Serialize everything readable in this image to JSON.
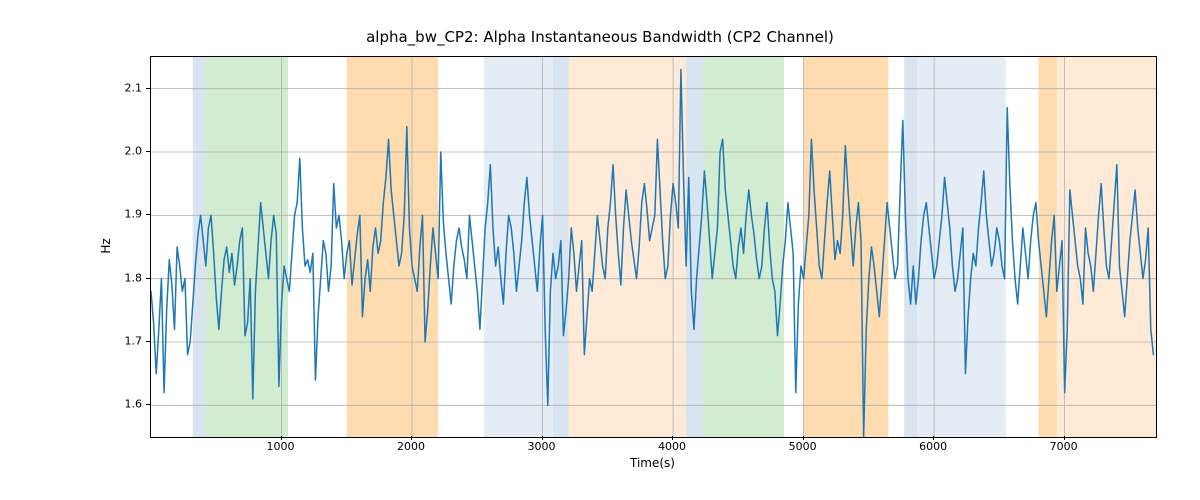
{
  "chart_data": {
    "type": "line",
    "title": "alpha_bw_CP2: Alpha Instantaneous Bandwidth (CP2 Channel)",
    "xlabel": "Time(s)",
    "ylabel": "Hz",
    "xlim": [
      0,
      7700
    ],
    "ylim": [
      1.55,
      2.15
    ],
    "x_ticks": [
      1000,
      2000,
      3000,
      4000,
      5000,
      6000,
      7000
    ],
    "y_ticks": [
      1.6,
      1.7,
      1.8,
      1.9,
      2.0,
      2.1
    ],
    "x_tick_labels": [
      "1000",
      "2000",
      "3000",
      "4000",
      "5000",
      "6000",
      "7000"
    ],
    "y_tick_labels": [
      "1.6",
      "1.7",
      "1.8",
      "1.9",
      "2.0",
      "2.1"
    ],
    "bands": [
      {
        "x0": 320,
        "x1": 420,
        "color": "blue"
      },
      {
        "x0": 420,
        "x1": 1050,
        "color": "green"
      },
      {
        "x0": 1500,
        "x1": 2200,
        "color": "orange"
      },
      {
        "x0": 2550,
        "x1": 3080,
        "color": "ltblue"
      },
      {
        "x0": 3080,
        "x1": 3200,
        "color": "blue"
      },
      {
        "x0": 3200,
        "x1": 4100,
        "color": "peach"
      },
      {
        "x0": 4100,
        "x1": 4230,
        "color": "blue"
      },
      {
        "x0": 4230,
        "x1": 4850,
        "color": "green"
      },
      {
        "x0": 5000,
        "x1": 5650,
        "color": "orange"
      },
      {
        "x0": 5770,
        "x1": 5870,
        "color": "blue"
      },
      {
        "x0": 5870,
        "x1": 6550,
        "color": "ltblue"
      },
      {
        "x0": 6800,
        "x1": 6940,
        "color": "orange"
      },
      {
        "x0": 6940,
        "x1": 7700,
        "color": "peach"
      }
    ],
    "series": [
      {
        "name": "alpha_bw_CP2",
        "x_start": 0,
        "x_step": 20,
        "y": [
          1.78,
          1.73,
          1.65,
          1.72,
          1.8,
          1.62,
          1.75,
          1.83,
          1.79,
          1.72,
          1.85,
          1.82,
          1.78,
          1.8,
          1.68,
          1.7,
          1.76,
          1.82,
          1.87,
          1.9,
          1.86,
          1.82,
          1.88,
          1.9,
          1.84,
          1.77,
          1.72,
          1.78,
          1.83,
          1.85,
          1.81,
          1.84,
          1.79,
          1.82,
          1.86,
          1.88,
          1.71,
          1.73,
          1.8,
          1.61,
          1.78,
          1.85,
          1.92,
          1.88,
          1.84,
          1.8,
          1.86,
          1.9,
          1.87,
          1.63,
          1.76,
          1.82,
          1.8,
          1.78,
          1.84,
          1.9,
          1.92,
          1.99,
          1.88,
          1.82,
          1.83,
          1.81,
          1.84,
          1.64,
          1.74,
          1.8,
          1.86,
          1.84,
          1.78,
          1.82,
          1.95,
          1.88,
          1.9,
          1.86,
          1.8,
          1.84,
          1.86,
          1.79,
          1.83,
          1.87,
          1.9,
          1.74,
          1.8,
          1.83,
          1.78,
          1.85,
          1.88,
          1.84,
          1.86,
          1.92,
          1.96,
          2.02,
          1.94,
          1.9,
          1.86,
          1.82,
          1.84,
          1.9,
          2.04,
          1.88,
          1.82,
          1.8,
          1.78,
          1.85,
          1.9,
          1.7,
          1.75,
          1.82,
          1.88,
          1.84,
          1.8,
          2.0,
          1.89,
          1.84,
          1.8,
          1.76,
          1.82,
          1.86,
          1.88,
          1.85,
          1.83,
          1.8,
          1.9,
          1.86,
          1.82,
          1.78,
          1.72,
          1.8,
          1.88,
          1.92,
          1.98,
          1.88,
          1.82,
          1.85,
          1.8,
          1.76,
          1.84,
          1.9,
          1.88,
          1.84,
          1.78,
          1.82,
          1.86,
          1.92,
          1.96,
          1.9,
          1.86,
          1.82,
          1.78,
          1.85,
          1.9,
          1.72,
          1.6,
          1.78,
          1.84,
          1.8,
          1.82,
          1.86,
          1.71,
          1.75,
          1.8,
          1.88,
          1.84,
          1.78,
          1.82,
          1.86,
          1.68,
          1.74,
          1.8,
          1.78,
          1.84,
          1.9,
          1.86,
          1.82,
          1.8,
          1.88,
          1.92,
          1.98,
          1.9,
          1.84,
          1.79,
          1.88,
          1.94,
          1.9,
          1.86,
          1.83,
          1.8,
          1.85,
          1.92,
          1.95,
          1.91,
          1.86,
          1.88,
          1.9,
          2.02,
          1.94,
          1.86,
          1.8,
          1.82,
          1.9,
          1.95,
          1.92,
          1.88,
          2.13,
          1.96,
          1.82,
          1.96,
          1.78,
          1.72,
          1.8,
          1.85,
          1.9,
          1.97,
          1.92,
          1.86,
          1.8,
          1.84,
          1.88,
          2.0,
          2.02,
          1.94,
          1.9,
          1.86,
          1.82,
          1.8,
          1.85,
          1.88,
          1.84,
          1.9,
          1.94,
          1.9,
          1.87,
          1.83,
          1.8,
          1.82,
          1.88,
          1.92,
          1.85,
          1.8,
          1.78,
          1.71,
          1.76,
          1.82,
          1.86,
          1.92,
          1.88,
          1.84,
          1.62,
          1.76,
          1.82,
          1.8,
          1.85,
          1.9,
          2.02,
          1.94,
          1.88,
          1.82,
          1.8,
          1.86,
          1.92,
          1.97,
          1.9,
          1.83,
          1.86,
          1.84,
          1.9,
          2.01,
          1.94,
          1.88,
          1.82,
          1.88,
          1.92,
          1.86,
          1.55,
          1.72,
          1.8,
          1.85,
          1.82,
          1.78,
          1.74,
          1.8,
          1.86,
          1.92,
          1.88,
          1.84,
          1.8,
          1.82,
          1.94,
          2.05,
          1.9,
          1.8,
          1.76,
          1.82,
          1.76,
          1.8,
          1.86,
          1.9,
          1.92,
          1.88,
          1.84,
          1.8,
          1.82,
          1.86,
          1.9,
          1.96,
          1.92,
          1.88,
          1.82,
          1.78,
          1.8,
          1.84,
          1.88,
          1.65,
          1.74,
          1.8,
          1.84,
          1.82,
          1.88,
          1.92,
          1.97,
          1.9,
          1.86,
          1.82,
          1.84,
          1.88,
          1.86,
          1.82,
          1.8,
          2.07,
          1.95,
          1.86,
          1.8,
          1.76,
          1.82,
          1.88,
          1.84,
          1.8,
          1.86,
          1.9,
          1.92,
          1.86,
          1.82,
          1.78,
          1.74,
          1.8,
          1.86,
          1.9,
          1.78,
          1.82,
          1.86,
          1.62,
          1.72,
          1.94,
          1.9,
          1.86,
          1.82,
          1.8,
          1.76,
          1.88,
          1.84,
          1.82,
          1.78,
          1.84,
          1.9,
          1.95,
          1.88,
          1.82,
          1.8,
          1.86,
          1.92,
          1.98,
          1.82,
          1.78,
          1.74,
          1.8,
          1.86,
          1.9,
          1.94,
          1.88,
          1.84,
          1.8,
          1.83,
          1.88,
          1.72,
          1.68
        ]
      }
    ]
  }
}
